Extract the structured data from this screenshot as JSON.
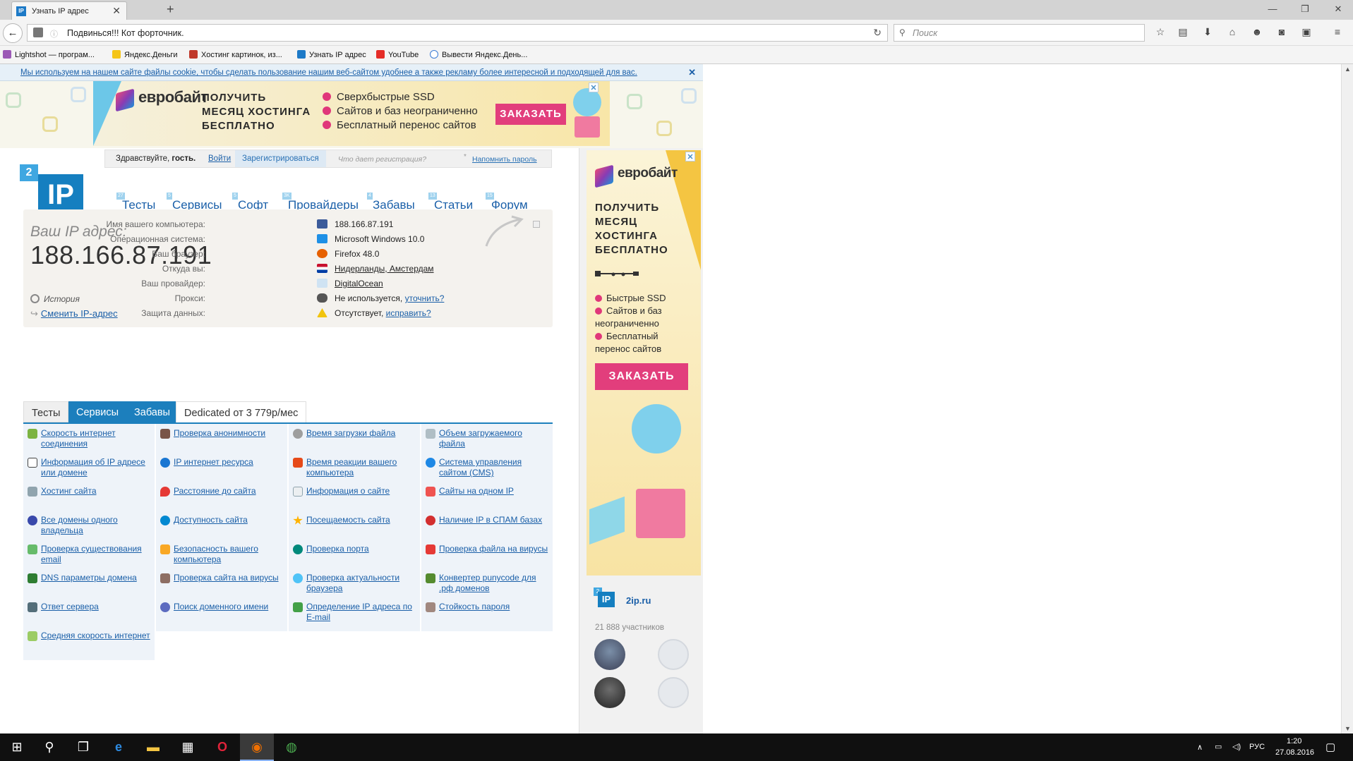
{
  "browser": {
    "tab_title": "Узнать IP адрес",
    "url_text": "Подвинься!!! Кот форточник.",
    "search_placeholder": "Поиск",
    "bookmarks": [
      "Lightshot — програм...",
      "Яндекс.Деньги",
      "Хостинг картинок, из...",
      "Узнать IP адрес",
      "YouTube",
      "Вывести Яндекс.День..."
    ]
  },
  "cookie_notice": "Мы используем на нашем сайте файлы cookie, чтобы сделать пользование нашим веб-сайтом удобнее а также рекламу более интересной и подходящей для вас.",
  "top_ad": {
    "brand": "евробайт",
    "headline": [
      "ПОЛУЧИТЬ",
      "МЕСЯЦ ХОСТИНГА",
      "БЕСПЛАТНО"
    ],
    "bullets": [
      "Сверхбыстрые SSD",
      "Сайтов и баз неограниченно",
      "Бесплатный перенос сайтов"
    ],
    "button": "ЗАКАЗАТЬ"
  },
  "login_bar": {
    "greeting_prefix": "Здравствуйте,",
    "greeting_user": "гость.",
    "login": "Войти",
    "register": "Зарегистрироваться",
    "why": "Что дает регистрация?",
    "remind": "Напомнить пароль"
  },
  "logo": {
    "badge": "2",
    "text": "IP"
  },
  "nav": [
    {
      "label": "Тесты",
      "count": "27"
    },
    {
      "label": "Сервисы",
      "count": "5"
    },
    {
      "label": "Софт",
      "count": "5"
    },
    {
      "label": "Провайдеры",
      "count": "3K"
    },
    {
      "label": "Забавы",
      "count": "4"
    },
    {
      "label": "Статьи",
      "count": "13"
    },
    {
      "label": "Форум",
      "count": "15"
    }
  ],
  "ip_info": {
    "label": "Ваш IP адрес:",
    "ip": "188.166.87.191",
    "history": "История",
    "change": "Сменить IP-адрес",
    "rows": [
      {
        "key": "Имя вашего компьютера:",
        "value": "188.166.87.191"
      },
      {
        "key": "Операционная система:",
        "value": "Microsoft Windows 10.0"
      },
      {
        "key": "Ваш браузер:",
        "value": "Firefox 48.0"
      },
      {
        "key": "Откуда вы:",
        "value": "Нидерланды, Амстердам"
      },
      {
        "key": "Ваш провайдер:",
        "value": "DigitalOcean"
      },
      {
        "key": "Прокси:",
        "value": "Не используется,",
        "link": "уточнить?"
      },
      {
        "key": "Защита данных:",
        "value": "Отсутствует,",
        "link": "исправить?"
      }
    ]
  },
  "section_tabs": [
    "Тесты",
    "Сервисы",
    "Забавы",
    "Dedicated от 3 779р/мес"
  ],
  "services": [
    [
      "Скорость интернет соединения",
      "Проверка анонимности",
      "Время загрузки файла",
      "Объем загружаемого файла"
    ],
    [
      "Информация об IP адресе или домене",
      "IP интернет ресурса",
      "Время реакции вашего компьютера",
      "Система управления сайтом (CMS)"
    ],
    [
      "Хостинг сайта",
      "Расстояние до сайта",
      "Информация о сайте",
      "Сайты на одном IP"
    ],
    [
      "Все домены одного владельца",
      "Доступность сайта",
      "Посещаемость сайта",
      "Наличие IP в СПАМ базах"
    ],
    [
      "Проверка существования email",
      "Безопасность вашего компьютера",
      "Проверка порта",
      "Проверка файла на вирусы"
    ],
    [
      "DNS параметры домена",
      "Проверка сайта на вирусы",
      "Проверка актуальности браузера",
      "Конвертер punycode для .рф доменов"
    ],
    [
      "Ответ сервера",
      "Поиск доменного имени",
      "Определение IP адреса по E-mail",
      "Стойкость пароля"
    ],
    [
      "Средняя скорость интернет"
    ]
  ],
  "side_ad": {
    "brand": "евробайт",
    "headline": [
      "ПОЛУЧИТЬ",
      "МЕСЯЦ",
      "ХОСТИНГА",
      "БЕСПЛАТНО"
    ],
    "bullets": [
      "Быстрые SSD",
      "Сайтов и баз",
      "неограниченно",
      "Бесплатный",
      "перенос сайтов"
    ],
    "button": "ЗАКАЗАТЬ"
  },
  "vk_widget": {
    "name": "2ip.ru",
    "members": "21 888 участников"
  },
  "taskbar": {
    "lang": "РУС",
    "time": "1:20",
    "date": "27.08.2016"
  }
}
